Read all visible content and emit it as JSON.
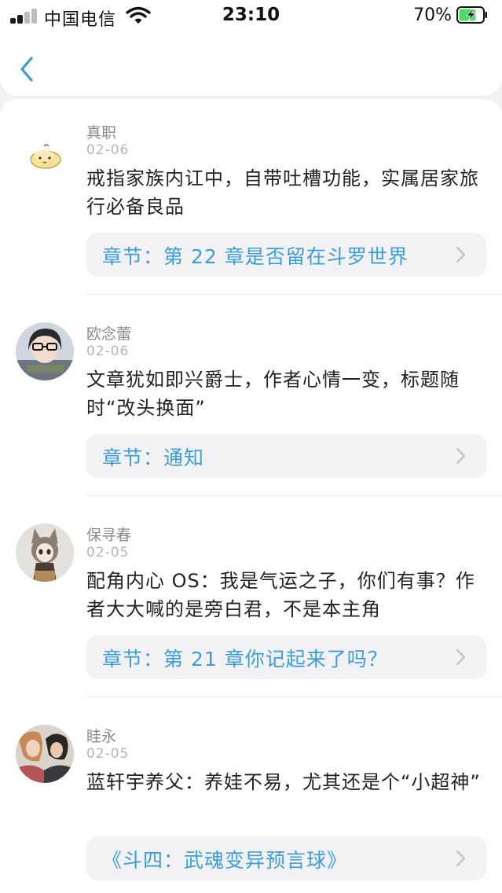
{
  "status_bar": {
    "carrier": "中国电信",
    "time": "23:10",
    "battery": "70%",
    "battery_level": 0.7
  },
  "header": {
    "back_icon": "chevron-left-icon"
  },
  "comments": [
    {
      "username": "真职",
      "date": "02-06",
      "text": "戒指家族内讧中，自带吐槽功能，实属居家旅行必备良品",
      "chapter": "章节：第 22 章是否留在斗罗世界",
      "avatar": "cartoon-hamster-avatar"
    },
    {
      "username": "欧念蕾",
      "date": "02-06",
      "text": "文章犹如即兴爵士，作者心情一变，标题随时“改头换面”",
      "chapter": "章节：通知",
      "avatar": "glasses-boy-avatar"
    },
    {
      "username": "保寻春",
      "date": "02-05",
      "text": "配角内心 OS：我是气运之子，你们有事？作者大大喊的是旁白君，不是本主角",
      "chapter": "章节：第 21 章你记起来了吗？",
      "avatar": "cat-ear-girl-avatar"
    },
    {
      "username": "眭永",
      "date": "02-05",
      "text": "蓝轩宇养父：养娃不易，尤其还是个“小超神”",
      "chapter": "《斗四：武魂变异预言球》",
      "avatar": "couple-photo-avatar"
    }
  ],
  "colors": {
    "accent": "#3b9ed7",
    "chip_bg": "#f2f2f4",
    "username": "#8a8a8a",
    "date": "#b5b5b5",
    "battery_green": "#4cd964"
  }
}
